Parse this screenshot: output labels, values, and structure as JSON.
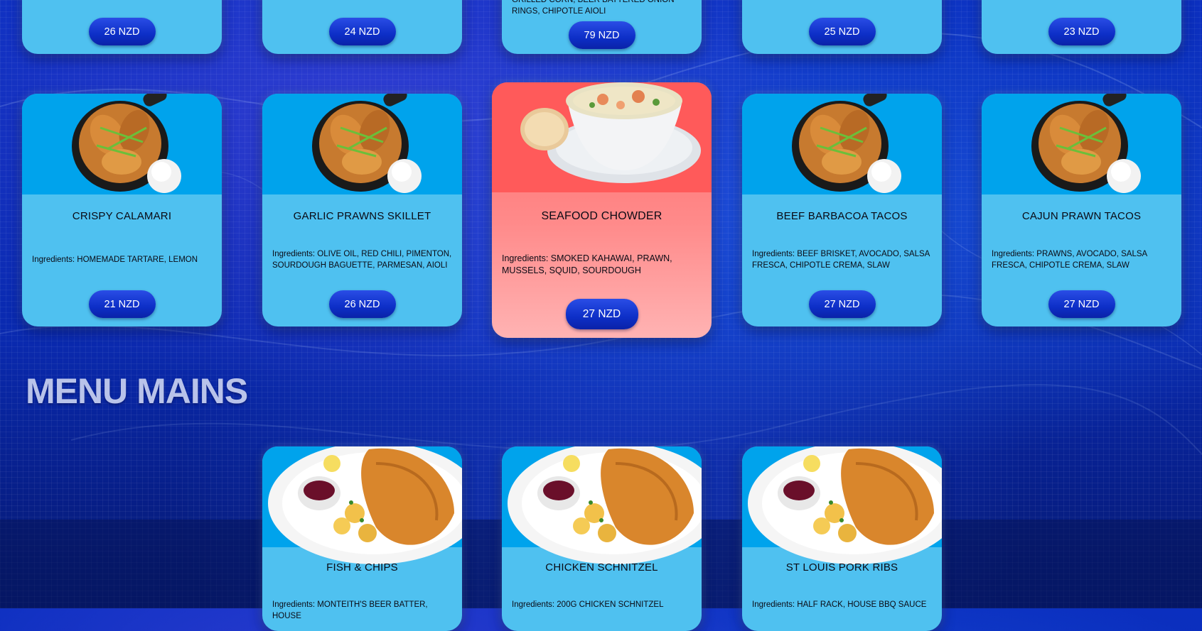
{
  "top_row": [
    {
      "price": "26 NZD"
    },
    {
      "price": "24 NZD"
    },
    {
      "ingredients": "GRILLED CORN, BEER BATTERED ONION RINGS, CHIPOTLE AIOLI",
      "price": "79 NZD"
    },
    {
      "price": "25 NZD"
    },
    {
      "price": "23 NZD"
    }
  ],
  "middle_row": [
    {
      "name": "CRISPY CALAMARI",
      "ingredients": "Ingredients: HOMEMADE TARTARE, LEMON",
      "price": "21 NZD"
    },
    {
      "name": "GARLIC PRAWNS SKILLET",
      "ingredients": "Ingredients: OLIVE OIL, RED CHILI, PIMENTON, SOURDOUGH BAGUETTE, PARMESAN, AIOLI",
      "price": "26 NZD"
    },
    {
      "name": "SEAFOOD CHOWDER",
      "ingredients": "Ingredients: SMOKED KAHAWAI, PRAWN, MUSSELS, SQUID, SOURDOUGH",
      "price": "27 NZD"
    },
    {
      "name": "BEEF BARBACOA TACOS",
      "ingredients": "Ingredients: BEEF BRISKET, AVOCADO, SALSA FRESCA, CHIPOTLE CREMA, SLAW",
      "price": "27 NZD"
    },
    {
      "name": "CAJUN PRAWN TACOS",
      "ingredients": "Ingredients: PRAWNS, AVOCADO, SALSA FRESCA, CHIPOTLE CREMA, SLAW",
      "price": "27 NZD"
    }
  ],
  "section": {
    "title": "MENU MAINS"
  },
  "mains": [
    {
      "name": "FISH & CHIPS",
      "ingredients": "Ingredients: MONTEITH'S BEER BATTER, HOUSE"
    },
    {
      "name": "CHICKEN SCHNITZEL",
      "ingredients": "Ingredients: 200G CHICKEN SCHNITZEL"
    },
    {
      "name": "ST LOUIS PORK RIBS",
      "ingredients": "Ingredients: HALF RACK, HOUSE BBQ SAUCE"
    }
  ],
  "icons": {
    "wings": "chicken-wings-skillet-image",
    "chowder": "seafood-chowder-bowl-image",
    "schnitzel": "schnitzel-plate-image"
  },
  "colors": {
    "card": "#4fc1f0",
    "card_image_band": "#00a3ec",
    "featured_card": "#ff6b6b",
    "price_button": "#0d2fc7",
    "section_title": "#b9c3ea"
  }
}
